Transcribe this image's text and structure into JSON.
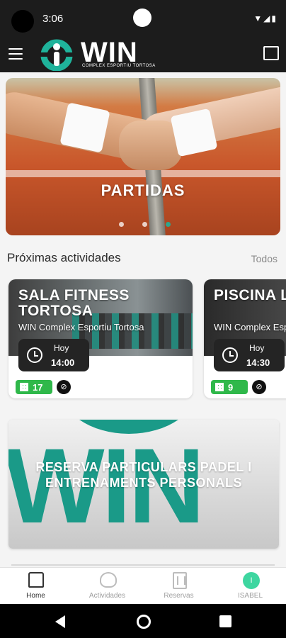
{
  "status_bar": {
    "time": "3:06",
    "icons": "▼◢▮"
  },
  "app_bar": {
    "logo_text": "WIN",
    "logo_subtitle": "COMPLEX ESPORTIU TORTOSA"
  },
  "hero": {
    "title": "PARTIDAS",
    "slides": 3,
    "active_slide": 3,
    "accent_color": "#2fa58d"
  },
  "upcoming": {
    "title": "Próximas actividades",
    "see_all": "Todos",
    "activities": [
      {
        "title": "SALA FITNESS TORTOSA",
        "venue": "WIN Complex Esportiu Tortosa",
        "day": "Hoy",
        "time": "14:00",
        "spots": "17"
      },
      {
        "title": "PISCINA L PETITA",
        "venue": "WIN Complex Esportiu Tortosa",
        "day": "Hoy",
        "time": "14:30",
        "spots": "9"
      }
    ]
  },
  "promo": {
    "background_text": "WIN",
    "text": "RESERVA PARTICULARS PADEL I ENTRENAMENTS PERSONALS"
  },
  "bottom_nav": {
    "items": [
      {
        "label": "Home",
        "icon": "home-icon",
        "active": true
      },
      {
        "label": "Actividades",
        "icon": "heart-icon",
        "active": false
      },
      {
        "label": "Reservas",
        "icon": "book-icon",
        "active": false
      },
      {
        "label": "ISABEL",
        "icon": "avatar",
        "initial": "I",
        "active": false
      }
    ]
  },
  "colors": {
    "brand": "#1a9a88",
    "badge_green": "#2fb84a",
    "dark": "#1c1c1c"
  }
}
